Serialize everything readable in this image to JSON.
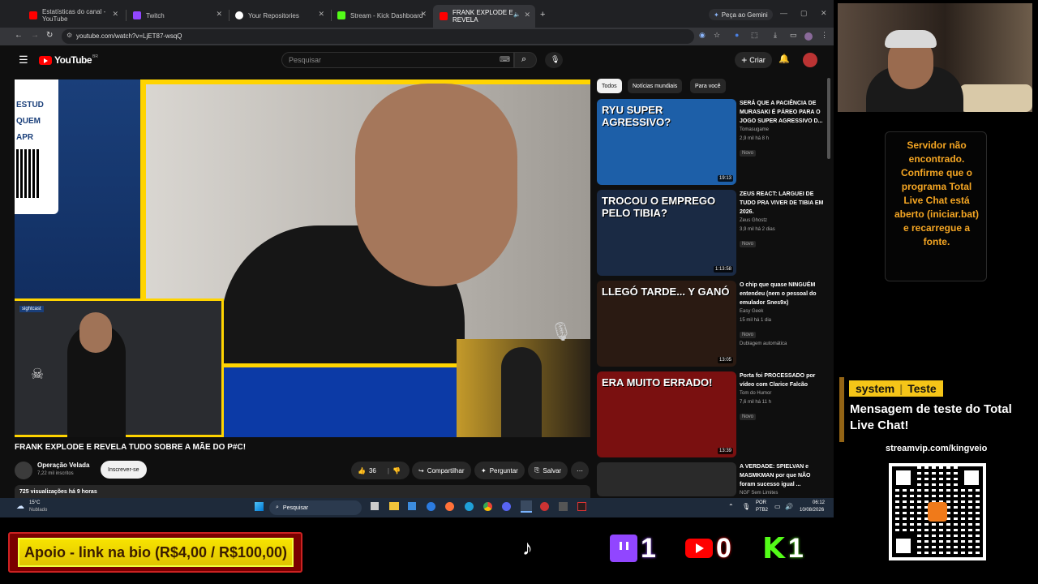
{
  "tabs": [
    {
      "label": "Estatísticas do canal - YouTube",
      "color": "#ff0000"
    },
    {
      "label": "Twitch",
      "color": "#9146ff"
    },
    {
      "label": "Your Repositories",
      "color": "#ffffff"
    },
    {
      "label": "Stream - Kick Dashboard",
      "color": "#53fc18"
    },
    {
      "label": "FRANK EXPLODE E REVELA",
      "color": "#ff0000"
    }
  ],
  "gemini_button": "Peça ao Gemini",
  "url": "youtube.com/watch?v=LjET87-wsqQ",
  "youtube": {
    "logo": "YouTube",
    "country": "BR",
    "search_placeholder": "Pesquisar",
    "create_label": "Criar",
    "video": {
      "title": "FRANK EXPLODE E REVELA TUDO SOBRE A MÃE DO P#C!",
      "channel": "Operação Velada",
      "subscribers": "7,22 mil inscritos",
      "subscribe_label": "Inscrever-se",
      "likes": "36",
      "share_label": "Compartilhar",
      "ask_label": "Perguntar",
      "save_label": "Salvar",
      "views": "725 visualizações  há 9 horas",
      "left_banner": "ESTUD QUEM APR",
      "brand_tag": "sightcast"
    },
    "chips": [
      "Todos",
      "Notícias mundiais",
      "Para você"
    ],
    "recommended": [
      {
        "title": "SERÁ QUE A PACIÊNCIA DE MURASAKI É PÁREO PARA O JOGO SUPER AGRESSIVO D...",
        "channel": "Tomasugame",
        "meta": "2,9 mil  há 8 h",
        "badge": "Novo",
        "duration": "19:13",
        "thumb_text": "RYU SUPER AGRESSIVO?",
        "thumb_color": "#1d5fa8"
      },
      {
        "title": "ZEUS REACT: LARGUEI DE TUDO PRA VIVER DE TIBIA EM 2026.",
        "channel": "Zeus Ghostz",
        "meta": "3,9 mil  há 2 dias",
        "badge": "Novo",
        "duration": "1:13:58",
        "thumb_text": "TROCOU O EMPREGO PELO TIBIA?",
        "thumb_color": "#1a2a44"
      },
      {
        "title": "O chip que quase NINGUÉM entendeu (nem o pessoal do emulador Snes9x)",
        "channel": "Easy Geek",
        "meta": "15 mil  há 1 dia",
        "badge": "Novo",
        "extra": "Dublagem automática",
        "duration": "13:05",
        "thumb_text": "LLEGÓ TARDE... Y GANÓ",
        "thumb_color": "#2a1a12"
      },
      {
        "title": "Porta foi PROCESSADO por vídeo com Clarice Falcão",
        "channel": "Tom do Humor",
        "meta": "7,6 mil  há 11 h",
        "badge": "Novo",
        "duration": "13:39",
        "thumb_text": "ERA MUITO ERRADO!",
        "thumb_color": "#7a1010"
      },
      {
        "title": "A VERDADE: SPIELVAN e MASMKMAN por que NÃO foram sucesso igual ...",
        "channel": "NGF Sem Limites",
        "meta": "",
        "badge": "",
        "duration": "",
        "thumb_text": "",
        "thumb_color": "#2a2a2a"
      }
    ]
  },
  "taskbar": {
    "temp": "15°C",
    "weather": "Nublado",
    "search": "Pesquisar",
    "lang": "POR",
    "layout": "PTB2",
    "time": "06:12",
    "date": "10/08/2026"
  },
  "overlay": {
    "chat_warning": "Servidor não encontrado. Confirme que o programa Total Live Chat está aberto (iniciar.bat) e recarregue a fonte.",
    "ghost_text": "encontrado",
    "chat_user": "system",
    "chat_badge": "Teste",
    "chat_message": "Mensagem de teste do Total Live Chat!",
    "stream_url": "streamvip.com/kingveio",
    "support_banner": "Apoio - link na bio (R$4,00 / R$100,00)",
    "counters": {
      "twitch": "1",
      "youtube": "0",
      "kick": "1"
    },
    "colors": {
      "twitch": "#9146ff",
      "youtube": "#ff0000",
      "kick": "#53fc18",
      "warning": "#f5a623",
      "support": "#f7e300"
    }
  }
}
